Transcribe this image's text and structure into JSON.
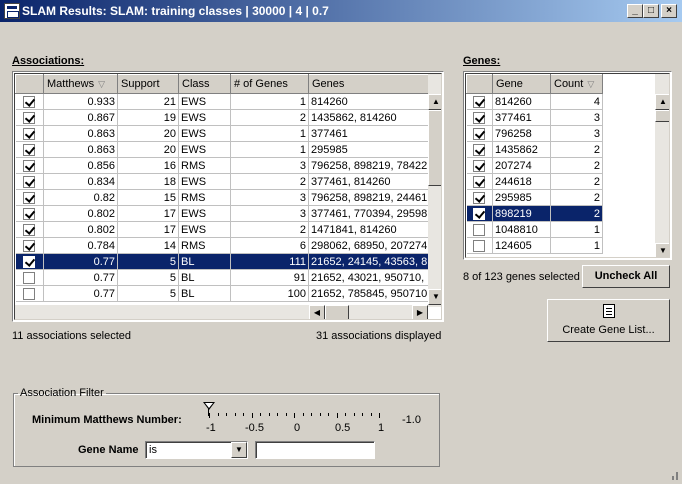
{
  "window": {
    "title": "SLAM Results: SLAM: training classes | 30000 | 4 | 0.7"
  },
  "associations": {
    "label": "Associations:",
    "columns": [
      "",
      "Matthews",
      "Support",
      "Class",
      "# of Genes",
      "Genes"
    ],
    "rows": [
      {
        "checked": true,
        "matthews": "0.933",
        "support": "21",
        "class": "EWS",
        "num_genes": "1",
        "genes": "814260",
        "selected": false
      },
      {
        "checked": true,
        "matthews": "0.867",
        "support": "19",
        "class": "EWS",
        "num_genes": "2",
        "genes": "1435862,  814260",
        "selected": false
      },
      {
        "checked": true,
        "matthews": "0.863",
        "support": "20",
        "class": "EWS",
        "num_genes": "1",
        "genes": "377461",
        "selected": false
      },
      {
        "checked": true,
        "matthews": "0.863",
        "support": "20",
        "class": "EWS",
        "num_genes": "1",
        "genes": "295985",
        "selected": false
      },
      {
        "checked": true,
        "matthews": "0.856",
        "support": "16",
        "class": "RMS",
        "num_genes": "3",
        "genes": "796258,  898219,  78422",
        "selected": false
      },
      {
        "checked": true,
        "matthews": "0.834",
        "support": "18",
        "class": "EWS",
        "num_genes": "2",
        "genes": "377461,  814260",
        "selected": false
      },
      {
        "checked": true,
        "matthews": "0.82",
        "support": "15",
        "class": "RMS",
        "num_genes": "3",
        "genes": "796258,  898219,  24461",
        "selected": false
      },
      {
        "checked": true,
        "matthews": "0.802",
        "support": "17",
        "class": "EWS",
        "num_genes": "3",
        "genes": "377461,  770394,  29598",
        "selected": false
      },
      {
        "checked": true,
        "matthews": "0.802",
        "support": "17",
        "class": "EWS",
        "num_genes": "2",
        "genes": "1471841,  814260",
        "selected": false
      },
      {
        "checked": true,
        "matthews": "0.784",
        "support": "14",
        "class": "RMS",
        "num_genes": "6",
        "genes": "298062,  68950,  207274",
        "selected": false
      },
      {
        "checked": true,
        "matthews": "0.77",
        "support": "5",
        "class": "BL",
        "num_genes": "111",
        "genes": "21652,  24145,  43563,  8",
        "selected": true
      },
      {
        "checked": false,
        "matthews": "0.77",
        "support": "5",
        "class": "BL",
        "num_genes": "91",
        "genes": "21652,  43021,  950710,",
        "selected": false
      },
      {
        "checked": false,
        "matthews": "0.77",
        "support": "5",
        "class": "BL",
        "num_genes": "100",
        "genes": "21652,  785845,  950710",
        "selected": false
      }
    ],
    "selected_status": "11 associations selected",
    "displayed_status": "31 associations displayed"
  },
  "genes": {
    "label": "Genes:",
    "columns": [
      "",
      "Gene",
      "Count"
    ],
    "rows": [
      {
        "checked": true,
        "gene": "814260",
        "count": "4",
        "selected": false
      },
      {
        "checked": true,
        "gene": "377461",
        "count": "3",
        "selected": false
      },
      {
        "checked": true,
        "gene": "796258",
        "count": "3",
        "selected": false
      },
      {
        "checked": true,
        "gene": "1435862",
        "count": "2",
        "selected": false
      },
      {
        "checked": true,
        "gene": "207274",
        "count": "2",
        "selected": false
      },
      {
        "checked": true,
        "gene": "244618",
        "count": "2",
        "selected": false
      },
      {
        "checked": true,
        "gene": "295985",
        "count": "2",
        "selected": false
      },
      {
        "checked": true,
        "gene": "898219",
        "count": "2",
        "selected": true
      },
      {
        "checked": false,
        "gene": "1048810",
        "count": "1",
        "selected": false
      },
      {
        "checked": false,
        "gene": "124605",
        "count": "1",
        "selected": false
      }
    ],
    "selected_status": "8 of 123 genes selected",
    "uncheck_all_label": "Uncheck All",
    "create_list_label": "Create Gene List..."
  },
  "filter": {
    "legend": "Association Filter",
    "matthews_label": "Minimum Matthews Number:",
    "slider_ticks": [
      "-1",
      "-0.5",
      "0",
      "0.5",
      "1"
    ],
    "slider_end_label": "-1.0",
    "slider_value": "-1",
    "gene_name_label": "Gene Name",
    "gene_name_mode": "is",
    "gene_name_value": ""
  },
  "colors": {
    "selection": "#0a246a",
    "face": "#d4d0c8"
  }
}
